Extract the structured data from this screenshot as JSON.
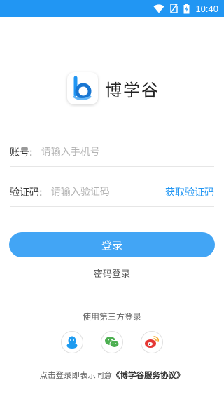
{
  "status_bar": {
    "time": "10:40",
    "icons": [
      "wifi-icon",
      "no-sim-icon",
      "battery-icon"
    ]
  },
  "app": {
    "name": "博学谷",
    "logo_icon": "b-logo-icon"
  },
  "account": {
    "label": "账号:",
    "placeholder": "请输入手机号"
  },
  "code": {
    "label": "验证码:",
    "placeholder": "请输入验证码",
    "get_code": "获取验证码"
  },
  "login_button": "登录",
  "password_login": "密码登录",
  "third_party": {
    "title": "使用第三方登录",
    "options": [
      "qq-icon",
      "wechat-icon",
      "weibo-icon"
    ]
  },
  "agreement": {
    "prefix": "点击登录即表示同意",
    "link": "《博学谷服务协议》"
  },
  "colors": {
    "primary": "#2196f3",
    "button": "#42a5f5",
    "qq": "#1e9bf0",
    "wechat": "#4caf50",
    "weibo": "#e53935"
  }
}
